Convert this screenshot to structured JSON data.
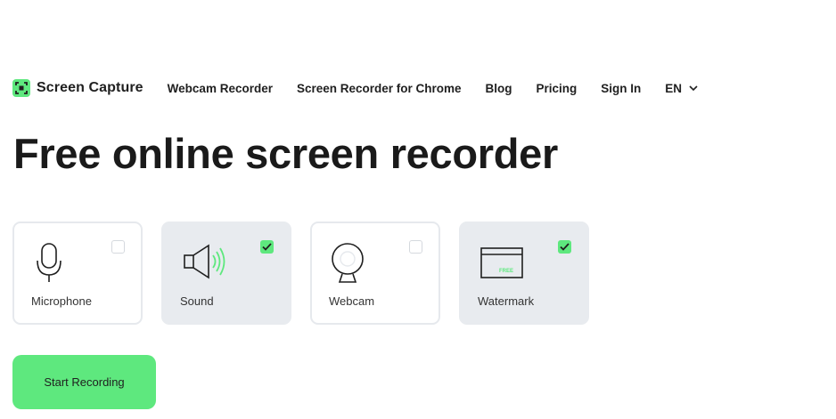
{
  "brand": {
    "name": "Screen Capture",
    "accent": "#5ee87e"
  },
  "nav": {
    "links": [
      "Webcam Recorder",
      "Screen Recorder for Chrome",
      "Blog",
      "Pricing",
      "Sign In"
    ],
    "language": "EN"
  },
  "hero": {
    "title": "Free online screen recorder"
  },
  "options": [
    {
      "label": "Microphone",
      "checked": false,
      "icon": "microphone-icon"
    },
    {
      "label": "Sound",
      "checked": true,
      "icon": "speaker-icon"
    },
    {
      "label": "Webcam",
      "checked": false,
      "icon": "webcam-icon"
    },
    {
      "label": "Watermark",
      "checked": true,
      "icon": "watermark-icon",
      "icon_text": "FREE"
    }
  ],
  "actions": {
    "start_label": "Start Recording"
  }
}
